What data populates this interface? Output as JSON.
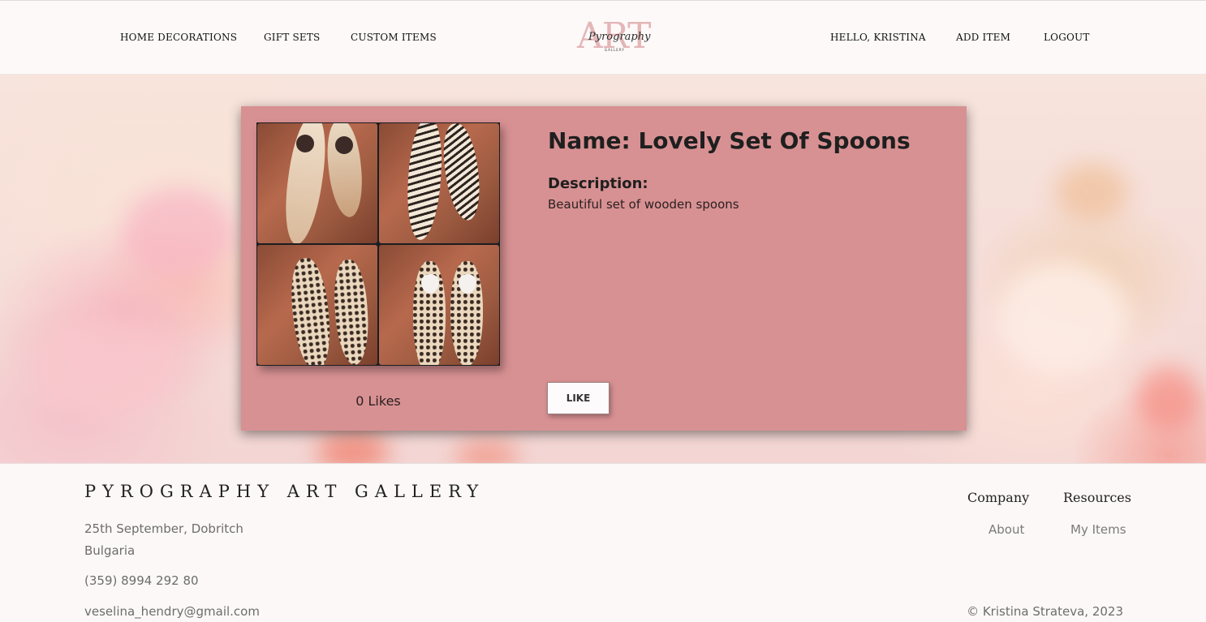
{
  "nav": {
    "left": [
      "HOME DECORATIONS",
      "GIFT SETS",
      "CUSTOM ITEMS"
    ],
    "right": [
      "HELLO, KRISTINA",
      "ADD ITEM",
      "LOGOUT"
    ]
  },
  "logo": {
    "big": "ART",
    "script": "Pyrography",
    "small": "GALLERY"
  },
  "product": {
    "name": "Name: Lovely Set Of Spoons",
    "description_label": "Description:",
    "description": "Beautiful set of wooden spoons",
    "likes": "0 Likes",
    "like_button": "LIKE"
  },
  "footer": {
    "brand": "PYROGRAPHY ART GALLERY",
    "address_line1": "25th September, Dobritch",
    "address_line2": "Bulgaria",
    "phone": "(359) 8994 292 80",
    "email": "veselina_hendry@gmail.com",
    "company_heading": "Company",
    "company_link": "About",
    "resources_heading": "Resources",
    "resources_link": "My Items",
    "copyright": "© Kristina Strateva, 2023"
  },
  "colors": {
    "card": "#d89193",
    "logo_accent": "#e3b6b8"
  }
}
